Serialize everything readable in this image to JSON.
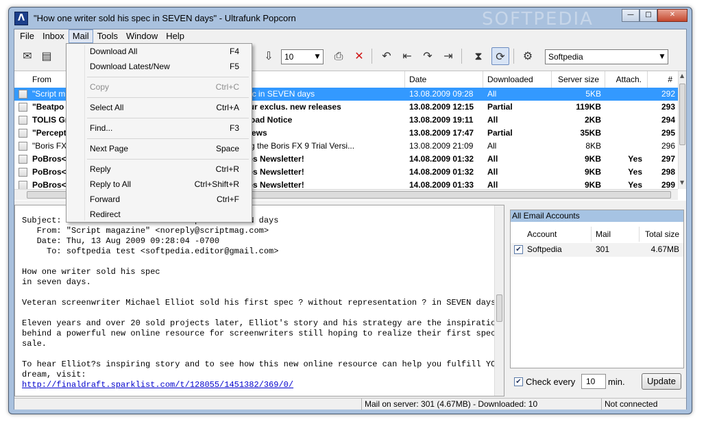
{
  "window": {
    "title": "\"How one writer sold his spec in SEVEN days\" - Ultrafunk Popcorn",
    "watermark": "SOFTPEDIA",
    "app_icon": "Λ",
    "controls": {
      "minimize": "—",
      "maximize": "□",
      "close": "✕"
    }
  },
  "menubar": [
    "File",
    "Inbox",
    "Mail",
    "Tools",
    "Window",
    "Help"
  ],
  "toolbar": {
    "count_value": "10",
    "account_value": "Softpedia"
  },
  "mail_menu": [
    {
      "label": "Download All",
      "shortcut": "F4",
      "enabled": true
    },
    {
      "label": "Download Latest/New",
      "shortcut": "F5",
      "enabled": true
    },
    {
      "label": "Copy",
      "shortcut": "Ctrl+C",
      "enabled": false
    },
    {
      "label": "Select All",
      "shortcut": "Ctrl+A",
      "enabled": true
    },
    {
      "label": "Find...",
      "shortcut": "F3",
      "enabled": true
    },
    {
      "label": "Next Page",
      "shortcut": "Space",
      "enabled": true
    },
    {
      "label": "Reply",
      "shortcut": "Ctrl+R",
      "enabled": true
    },
    {
      "label": "Reply to All",
      "shortcut": "Ctrl+Shift+R",
      "enabled": true
    },
    {
      "label": "Forward",
      "shortcut": "Ctrl+F",
      "enabled": true
    },
    {
      "label": "Redirect",
      "shortcut": "",
      "enabled": true
    }
  ],
  "message_list": {
    "columns": [
      "From",
      "Date",
      "Downloaded",
      "Server size",
      "Attach.",
      "#"
    ],
    "rows": [
      {
        "from": "\"Script m",
        "subject": "r sold his spec in SEVEN days",
        "date": "13.08.2009 09:28",
        "downloaded": "All",
        "size": "5KB",
        "attach": "",
        "num": "292",
        "bold": false,
        "selected": true
      },
      {
        "from": "\"Beatpo",
        "subject": "heck out your exclus. new releases",
        "date": "13.08.2009 12:15",
        "downloaded": "Partial",
        "size": "119KB",
        "attach": "",
        "num": "293",
        "bold": true,
        "selected": false
      },
      {
        "from": "TOLIS Gr",
        "subject": "ation Download Notice",
        "date": "13.08.2009 19:11",
        "downloaded": "All",
        "size": "2KB",
        "attach": "",
        "num": "294",
        "bold": true,
        "selected": false
      },
      {
        "from": "\"Percept",
        "subject": "utomation News",
        "date": "13.08.2009 17:47",
        "downloaded": "Partial",
        "size": "35KB",
        "attach": "",
        "num": "295",
        "bold": true,
        "selected": false
      },
      {
        "from": "\"Boris FX",
        "subject": "r downloading the Boris FX 9 Trial Versi...",
        "date": "13.08.2009 21:09",
        "downloaded": "All",
        "size": "8KB",
        "attach": "",
        "num": "296",
        "bold": false,
        "selected": false
      },
      {
        "from": "PoBros<",
        "subject": "of the PoBros Newsletter!",
        "date": "14.08.2009 01:32",
        "downloaded": "All",
        "size": "9KB",
        "attach": "Yes",
        "num": "297",
        "bold": true,
        "selected": false
      },
      {
        "from": "PoBros<",
        "subject": "of the PoBros Newsletter!",
        "date": "14.08.2009 01:32",
        "downloaded": "All",
        "size": "9KB",
        "attach": "Yes",
        "num": "298",
        "bold": true,
        "selected": false
      },
      {
        "from": "PoBros<",
        "subject": "of the PoBros Newsletter!",
        "date": "14.08.2009 01:33",
        "downloaded": "All",
        "size": "9KB",
        "attach": "Yes",
        "num": "299",
        "bold": true,
        "selected": false
      }
    ]
  },
  "preview": {
    "header_lines": [
      "Subject: \"How one writer sold his spec in SEVEN days",
      "   From: \"Script magazine\" <noreply@scriptmag.com>",
      "   Date: Thu, 13 Aug 2009 09:28:04 -0700",
      "     To: softpedia test <softpedia.editor@gmail.com>"
    ],
    "body": "How one writer sold his spec\nin seven days.\n\nVeteran screenwriter Michael Elliot sold his first spec ? without representation ? in SEVEN days.\n\nEleven years and over 20 sold projects later, Elliot's story and his strategy are the inspiration\nbehind a powerful new online resource for screenwriters still hoping to realize their first spec\nsale.\n\nTo hear Elliot?s inspiring story and to see how this new online resource can help you fulfill YOUR\ndream, visit:",
    "link": "http://finaldraft.sparklist.com/t/128055/1451382/369/0/"
  },
  "accounts_panel": {
    "title": "All Email Accounts",
    "columns": [
      "Account",
      "Mail",
      "Total size"
    ],
    "rows": [
      {
        "account": "Softpedia",
        "mail": "301",
        "total": "4.67MB",
        "checked": true
      }
    ]
  },
  "check_every": {
    "label": "Check every",
    "value": "10",
    "unit": "min.",
    "button": "Update"
  },
  "statusbar": {
    "mail_info": "Mail on server: 301 (4.67MB) - Downloaded: 10",
    "connection": "Not connected"
  }
}
